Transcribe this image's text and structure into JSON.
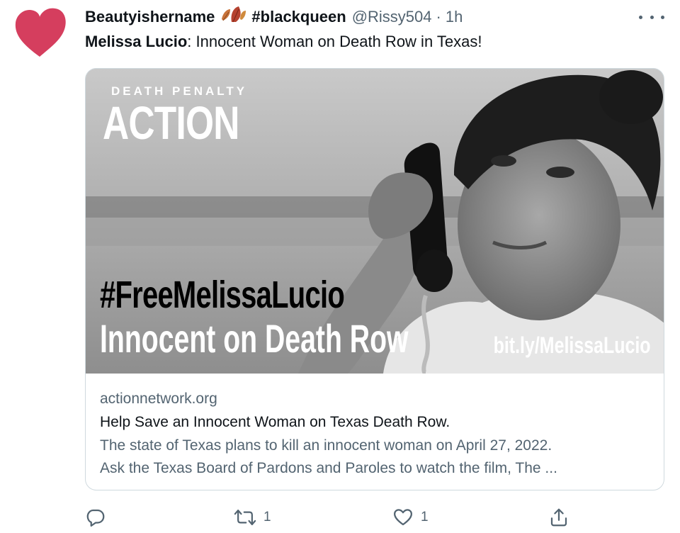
{
  "author": {
    "name": "Beautyishername",
    "emoji_icon": "fall-leaf-icon",
    "hashtag": "#blackqueen",
    "handle": "@Rissy504",
    "separator": "·",
    "time": "1h"
  },
  "tweet": {
    "bold_part": "Melissa Lucio",
    "rest": ": Innocent Woman on Death Row in Texas!"
  },
  "card": {
    "image": {
      "org_top": "DEATH PENALTY",
      "org_main": "ACTION",
      "hashtag": "#FreeMelissaLucio",
      "subtitle": "Innocent on Death Row",
      "link": "bit.ly/MelissaLucio"
    },
    "domain": "actionnetwork.org",
    "title": "Help Save an Innocent Woman on Texas Death Row.",
    "description_line1": "The state of Texas plans to kill an innocent woman on April 27, 2022.",
    "description_line2": "Ask the Texas Board of Pardons and Paroles to watch the film, The ..."
  },
  "actions": {
    "reply": {
      "icon": "reply-icon",
      "count": ""
    },
    "retweet": {
      "icon": "retweet-icon",
      "count": "1"
    },
    "like": {
      "icon": "heart-outline-icon",
      "count": "1"
    },
    "share": {
      "icon": "share-icon"
    }
  },
  "colors": {
    "avatar_heart": "#d53e5e",
    "text_primary": "#0f1419",
    "text_secondary": "#536471",
    "border": "#cfd9de"
  }
}
